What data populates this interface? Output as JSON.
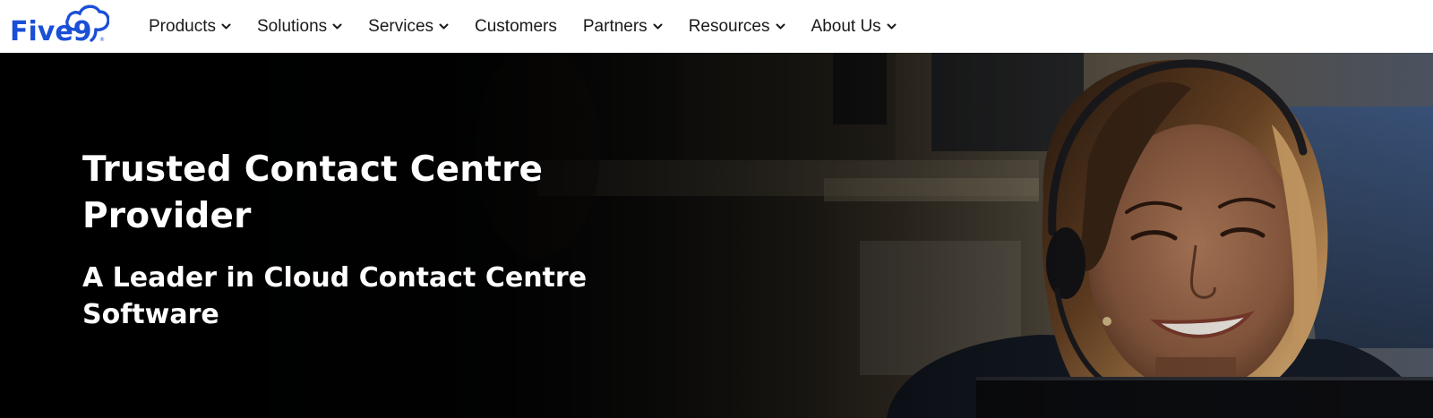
{
  "header": {
    "logo": {
      "text": "Five9",
      "icon": "cloud-logo-icon",
      "registered_mark": "®",
      "color": "#1b4fd8"
    },
    "nav": [
      {
        "label": "Products",
        "has_dropdown": true,
        "icon": "chevron-down-icon"
      },
      {
        "label": "Solutions",
        "has_dropdown": true,
        "icon": "chevron-down-icon"
      },
      {
        "label": "Services",
        "has_dropdown": true,
        "icon": "chevron-down-icon"
      },
      {
        "label": "Customers",
        "has_dropdown": false
      },
      {
        "label": "Partners",
        "has_dropdown": true,
        "icon": "chevron-down-icon"
      },
      {
        "label": "Resources",
        "has_dropdown": true,
        "icon": "chevron-down-icon"
      },
      {
        "label": "About Us",
        "has_dropdown": true,
        "icon": "chevron-down-icon"
      }
    ]
  },
  "hero": {
    "title": "Trusted Contact Centre Provider",
    "subtitle": "A Leader in Cloud Contact Centre Software",
    "image": "smiling-agent-with-headset-photo",
    "text_color": "#ffffff",
    "background_color": "#07090b"
  }
}
